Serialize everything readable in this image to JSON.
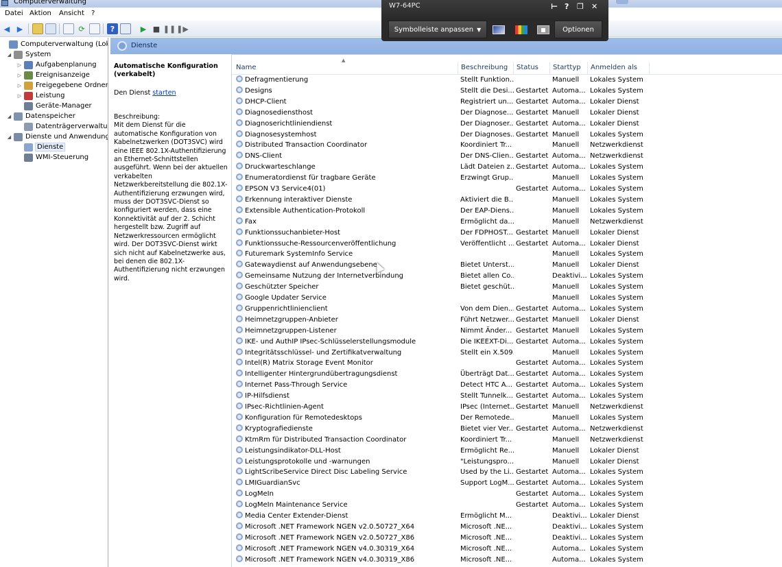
{
  "window": {
    "title": "Computerverwaltung"
  },
  "menu": [
    "Datei",
    "Aktion",
    "Ansicht",
    "?"
  ],
  "tree": [
    {
      "label": "Computerverwaltung (Lokal)",
      "level": 0,
      "arrow": "",
      "icon": "computer-icon",
      "color": "#6b8fc4"
    },
    {
      "label": "System",
      "level": 1,
      "arrow": "◢",
      "icon": "tools-icon",
      "color": "#8e8e8e"
    },
    {
      "label": "Aufgabenplanung",
      "level": 2,
      "arrow": "▷",
      "icon": "clock-icon",
      "color": "#5b7fb8"
    },
    {
      "label": "Ereignisanzeige",
      "level": 2,
      "arrow": "▷",
      "icon": "event-viewer-icon",
      "color": "#6a8a4a"
    },
    {
      "label": "Freigegebene Ordner",
      "level": 2,
      "arrow": "▷",
      "icon": "shared-folder-icon",
      "color": "#d1a23b"
    },
    {
      "label": "Leistung",
      "level": 2,
      "arrow": "▷",
      "icon": "performance-icon",
      "color": "#c23b3b"
    },
    {
      "label": "Geräte-Manager",
      "level": 2,
      "arrow": "",
      "icon": "device-manager-icon",
      "color": "#6d7f95"
    },
    {
      "label": "Datenspeicher",
      "level": 1,
      "arrow": "◢",
      "icon": "storage-icon",
      "color": "#7f93ad"
    },
    {
      "label": "Datenträgerverwaltung",
      "level": 2,
      "arrow": "",
      "icon": "disk-icon",
      "color": "#8c9bb0"
    },
    {
      "label": "Dienste und Anwendungen",
      "level": 1,
      "arrow": "◢",
      "icon": "services-apps-icon",
      "color": "#7b8ca3"
    },
    {
      "label": "Dienste",
      "level": 2,
      "arrow": "",
      "icon": "gear-icon",
      "color": "#8aa6cf",
      "selected": true
    },
    {
      "label": "WMI-Steuerung",
      "level": 2,
      "arrow": "",
      "icon": "wmi-icon",
      "color": "#6f7e92"
    }
  ],
  "panel": {
    "title": "Dienste"
  },
  "detail": {
    "title": "Automatische Konfiguration (verkabelt)",
    "action_prefix": "Den Dienst ",
    "action_link": "starten",
    "desc_label": "Beschreibung:",
    "description": "Mit dem Dienst für die automatische Konfiguration von Kabelnetzwerken (DOT3SVC) wird eine IEEE 802.1X-Authentifizierung an Ethernet-Schnittstellen ausgeführt. Wenn bei der aktuellen verkabelten Netzwerkbereitstellung die 802.1X-Authentifizierung erzwungen wird, muss der DOT3SVC-Dienst so konfiguriert werden, dass eine Konnektivität auf der 2. Schicht hergestellt bzw. Zugriff auf Netzwerkressourcen ermöglicht wird. Der DOT3SVC-Dienst wirkt sich nicht auf Kabelnetzwerke aus, bei denen die 802.1X-Authentifizierung nicht erzwungen wird."
  },
  "columns": [
    "Name",
    "Beschreibung",
    "Status",
    "Starttyp",
    "Anmelden als"
  ],
  "services": [
    [
      "Defragmentierung",
      "Stellt Funktion...",
      "",
      "Manuell",
      "Lokales System"
    ],
    [
      "Designs",
      "Stellt die Desi...",
      "Gestartet",
      "Automa...",
      "Lokales System"
    ],
    [
      "DHCP-Client",
      "Registriert un...",
      "Gestartet",
      "Automa...",
      "Lokaler Dienst"
    ],
    [
      "Diagnosediensthost",
      "Der Diagnose...",
      "Gestartet",
      "Manuell",
      "Lokaler Dienst"
    ],
    [
      "Diagnoserichtliniendienst",
      "Der Diagnoser...",
      "Gestartet",
      "Automa...",
      "Lokaler Dienst"
    ],
    [
      "Diagnosesystemhost",
      "Der Diagnoses...",
      "Gestartet",
      "Manuell",
      "Lokales System"
    ],
    [
      "Distributed Transaction Coordinator",
      "Koordiniert Tr...",
      "",
      "Manuell",
      "Netzwerkdienst"
    ],
    [
      "DNS-Client",
      "Der DNS-Clien...",
      "Gestartet",
      "Automa...",
      "Netzwerkdienst"
    ],
    [
      "Druckwarteschlange",
      "Lädt Dateien z...",
      "Gestartet",
      "Automa...",
      "Lokales System"
    ],
    [
      "Enumeratordienst für tragbare Geräte",
      "Erzwingt Grup...",
      "",
      "Manuell",
      "Lokales System"
    ],
    [
      "EPSON V3 Service4(01)",
      "",
      "Gestartet",
      "Automa...",
      "Lokales System"
    ],
    [
      "Erkennung interaktiver Dienste",
      "Aktiviert die B...",
      "",
      "Manuell",
      "Lokales System"
    ],
    [
      "Extensible Authentication-Protokoll",
      "Der EAP-Diens...",
      "",
      "Manuell",
      "Lokales System"
    ],
    [
      "Fax",
      "Ermöglicht da...",
      "",
      "Manuell",
      "Netzwerkdienst"
    ],
    [
      "Funktionssuchanbieter-Host",
      "Der FDPHOST...",
      "Gestartet",
      "Manuell",
      "Lokaler Dienst"
    ],
    [
      "Funktionssuche-Ressourcenveröffentlichung",
      "Veröffentlicht ...",
      "Gestartet",
      "Automa...",
      "Lokaler Dienst"
    ],
    [
      "Futuremark SystemInfo Service",
      "",
      "",
      "Manuell",
      "Lokales System"
    ],
    [
      "Gatewaydienst auf Anwendungsebene",
      "Bietet Unterst...",
      "",
      "Manuell",
      "Lokaler Dienst"
    ],
    [
      "Gemeinsame Nutzung der Internetverbindung",
      "Bietet allen Co...",
      "",
      "Deaktivi...",
      "Lokales System"
    ],
    [
      "Geschützter Speicher",
      "Bietet geschüt...",
      "",
      "Manuell",
      "Lokales System"
    ],
    [
      "Google Updater Service",
      "",
      "",
      "Manuell",
      "Lokales System"
    ],
    [
      "Gruppenrichtlinienclient",
      "Von dem Dien...",
      "Gestartet",
      "Automa...",
      "Lokales System"
    ],
    [
      "Heimnetzgruppen-Anbieter",
      "Führt Netzwer...",
      "Gestartet",
      "Manuell",
      "Lokaler Dienst"
    ],
    [
      "Heimnetzgruppen-Listener",
      "Nimmt Änder...",
      "Gestartet",
      "Manuell",
      "Lokales System"
    ],
    [
      "IKE- und AuthIP IPsec-Schlüsselerstellungsmodule",
      "Die IKEEXT-Di...",
      "Gestartet",
      "Automa...",
      "Lokales System"
    ],
    [
      "Integritätsschlüssel- und Zertifikatverwaltung",
      "Stellt ein X.509...",
      "",
      "Manuell",
      "Lokales System"
    ],
    [
      "Intel(R) Matrix Storage Event Monitor",
      "",
      "Gestartet",
      "Automa...",
      "Lokales System"
    ],
    [
      "Intelligenter Hintergrundübertragungsdienst",
      "Überträgt Dat...",
      "Gestartet",
      "Automa...",
      "Lokales System"
    ],
    [
      "Internet Pass-Through Service",
      "Detect HTC A...",
      "Gestartet",
      "Automa...",
      "Lokales System"
    ],
    [
      "IP-Hilfsdienst",
      "Stellt Tunnelk...",
      "Gestartet",
      "Automa...",
      "Lokales System"
    ],
    [
      "IPsec-Richtlinien-Agent",
      "IPsec (Internet...",
      "Gestartet",
      "Manuell",
      "Netzwerkdienst"
    ],
    [
      "Konfiguration für Remotedesktops",
      "Der Remotede...",
      "",
      "Manuell",
      "Lokales System"
    ],
    [
      "Kryptografiedienste",
      "Bietet vier Ver...",
      "Gestartet",
      "Automa...",
      "Netzwerkdienst"
    ],
    [
      "KtmRm für Distributed Transaction Coordinator",
      "Koordiniert Tr...",
      "",
      "Manuell",
      "Netzwerkdienst"
    ],
    [
      "Leistungsindikator-DLL-Host",
      "Ermöglicht Re...",
      "",
      "Manuell",
      "Lokaler Dienst"
    ],
    [
      "Leistungsprotokolle und -warnungen",
      "\"Leistungspro...",
      "",
      "Manuell",
      "Lokaler Dienst"
    ],
    [
      "LightScribeService Direct Disc Labeling Service",
      "Used by the Li...",
      "Gestartet",
      "Automa...",
      "Lokales System"
    ],
    [
      "LMIGuardianSvc",
      "Support LogM...",
      "Gestartet",
      "Automa...",
      "Lokales System"
    ],
    [
      "LogMeIn",
      "",
      "Gestartet",
      "Automa...",
      "Lokales System"
    ],
    [
      "LogMeIn Maintenance Service",
      "",
      "Gestartet",
      "Automa...",
      "Lokales System"
    ],
    [
      "Media Center Extender-Dienst",
      "Ermöglicht M...",
      "",
      "Deaktivi...",
      "Lokaler Dienst"
    ],
    [
      "Microsoft .NET Framework NGEN v2.0.50727_X64",
      "Microsoft .NE...",
      "",
      "Deaktivi...",
      "Lokales System"
    ],
    [
      "Microsoft .NET Framework NGEN v2.0.50727_X86",
      "Microsoft .NE...",
      "",
      "Deaktivi...",
      "Lokales System"
    ],
    [
      "Microsoft .NET Framework NGEN v4.0.30319_X64",
      "Microsoft .NE...",
      "",
      "Automa...",
      "Lokales System"
    ],
    [
      "Microsoft .NET Framework NGEN v4.0.30319_X86",
      "Microsoft .NE...",
      "",
      "Automa...",
      "Lokales System"
    ]
  ],
  "remote": {
    "name": "W7-64PC",
    "toolbar_button": "Symbolleiste anpassen",
    "options_button": "Optionen"
  }
}
